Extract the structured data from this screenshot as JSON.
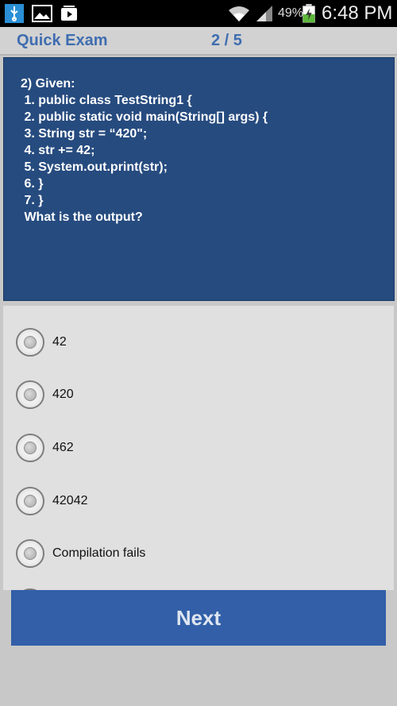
{
  "status_bar": {
    "battery_percent": "49%",
    "time": "6:48 PM",
    "icons": [
      "usb-icon",
      "gallery-icon",
      "video-icon",
      "wifi-icon",
      "signal-icon",
      "battery-charging-icon"
    ]
  },
  "header": {
    "title": "Quick Exam",
    "progress": "2 / 5"
  },
  "question": {
    "text": "2) Given:\n 1. public class TestString1 {\n 2. public static void main(String[] args) {\n 3. String str = “420\";\n 4. str += 42;\n 5. System.out.print(str);\n 6. }\n 7. }\n What is the output?"
  },
  "options": [
    {
      "label": "42",
      "selected": false
    },
    {
      "label": "420",
      "selected": false
    },
    {
      "label": "462",
      "selected": false
    },
    {
      "label": "42042",
      "selected": false
    },
    {
      "label": "Compilation fails",
      "selected": false
    }
  ],
  "next_button": {
    "label": "Next"
  },
  "colors": {
    "accent": "#3f6db0",
    "question_bg": "#264b7f",
    "button_bg": "#325fa8"
  }
}
